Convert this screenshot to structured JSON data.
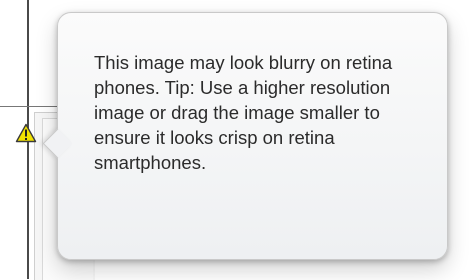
{
  "tooltip": {
    "message": "This image may look blurry on retina phones. Tip: Use a higher resolution image or drag the image smaller to ensure it looks crisp on retina smartphones."
  },
  "warning": {
    "icon": "warning-triangle-icon",
    "color": "#f2e200"
  }
}
